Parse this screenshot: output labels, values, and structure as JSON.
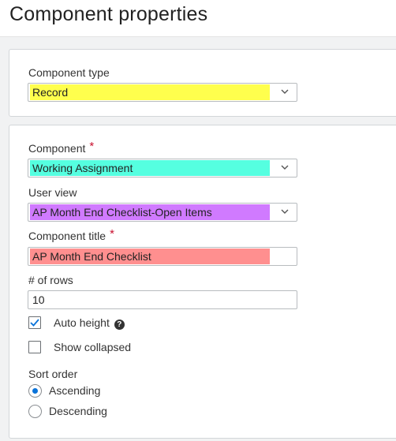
{
  "page": {
    "title": "Component properties"
  },
  "panel_type": {
    "component_type": {
      "label": "Component type",
      "value": "Record",
      "highlight": "#ffff4d"
    }
  },
  "panel_main": {
    "component": {
      "label": "Component",
      "required_mark": "*",
      "value": "Working Assignment",
      "highlight": "#55ffe0"
    },
    "user_view": {
      "label": "User view",
      "value": "AP Month End Checklist-Open Items",
      "highlight": "#d07aff"
    },
    "component_title": {
      "label": "Component title",
      "required_mark": "*",
      "value": "AP Month End Checklist",
      "highlight": "#ff8f8f"
    },
    "rows": {
      "label": "# of rows",
      "value": "10"
    },
    "auto_height": {
      "label": "Auto height",
      "checked": true,
      "help_icon": "?"
    },
    "show_collapsed": {
      "label": "Show collapsed",
      "checked": false
    },
    "sort_order": {
      "label": "Sort order",
      "options": [
        "Ascending",
        "Descending"
      ],
      "selected": "Ascending"
    }
  },
  "colors": {
    "accent": "#0a73d9",
    "required": "#c8102e",
    "border": "#b8bcbf",
    "background": "#f1f2f3"
  }
}
